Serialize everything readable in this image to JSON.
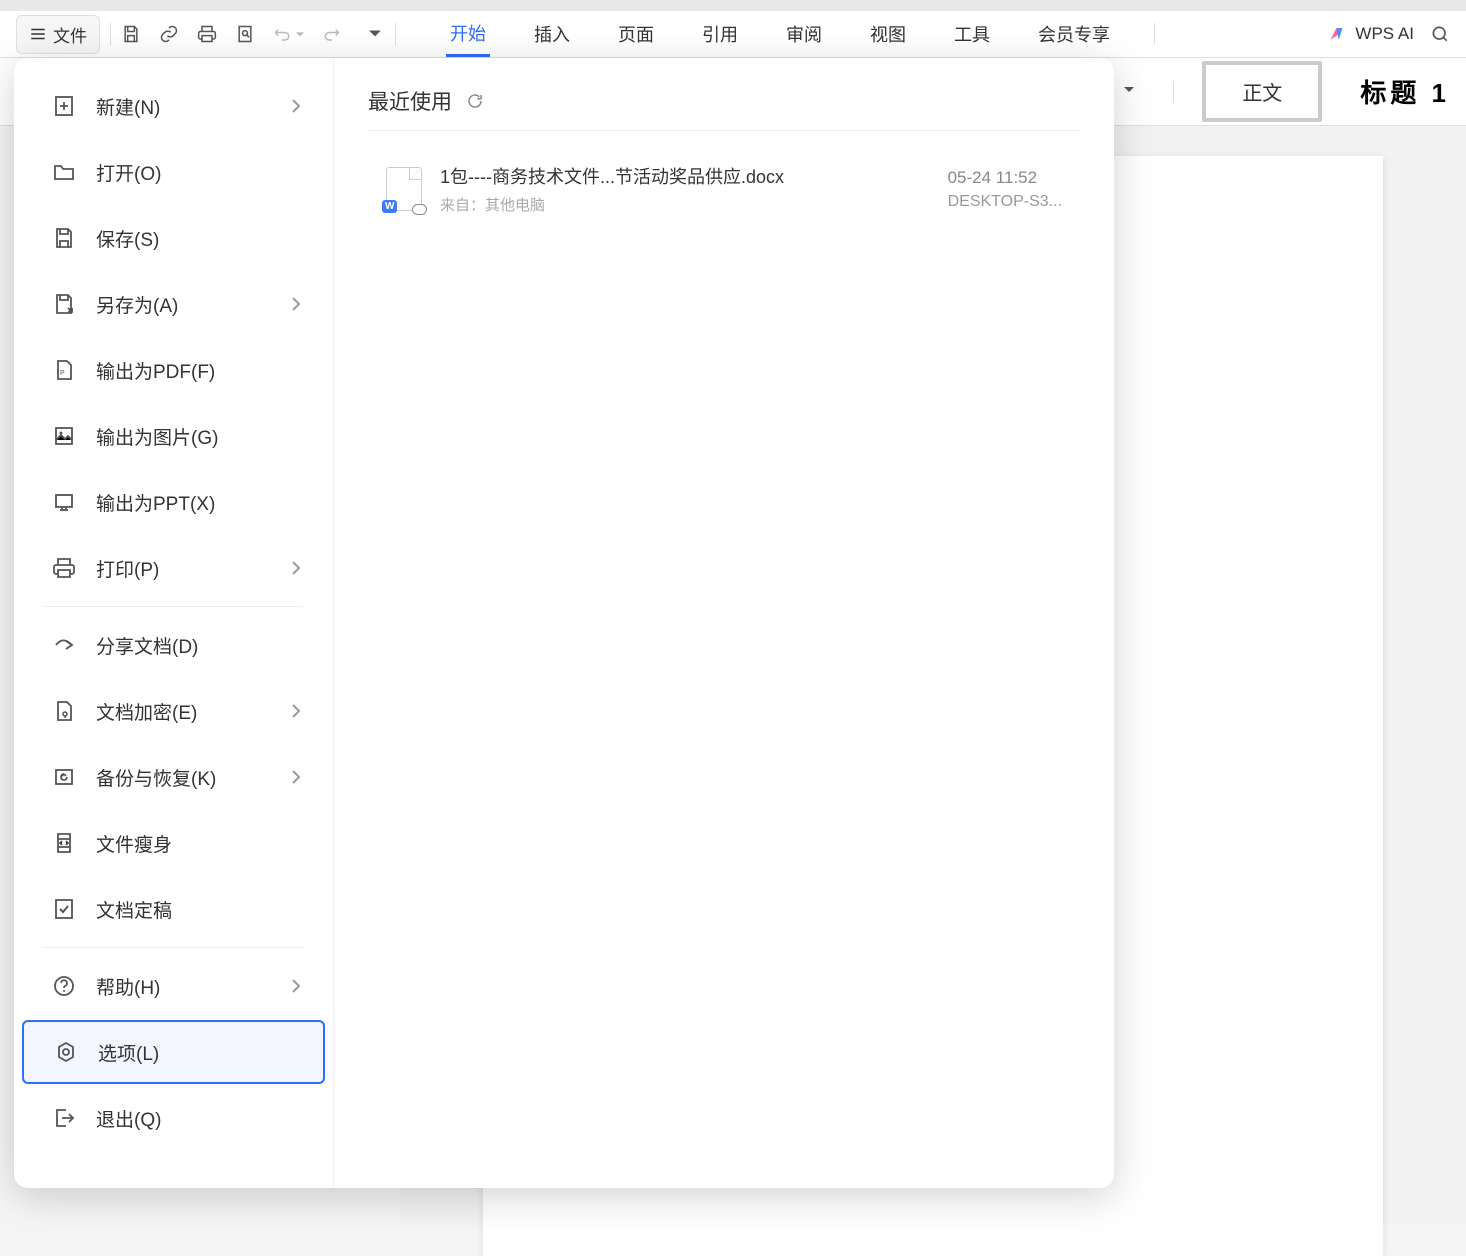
{
  "toolbar": {
    "file_label": "文件",
    "tabs": {
      "start": "开始",
      "insert": "插入",
      "page": "页面",
      "refs": "引用",
      "review": "审阅",
      "view": "视图",
      "tools": "工具",
      "vip": "会员专享"
    },
    "wps_ai": "WPS AI"
  },
  "file_menu": {
    "new": "新建(N)",
    "open": "打开(O)",
    "save": "保存(S)",
    "saveas": "另存为(A)",
    "export_pdf": "输出为PDF(F)",
    "export_img": "输出为图片(G)",
    "export_ppt": "输出为PPT(X)",
    "print": "打印(P)",
    "share": "分享文档(D)",
    "encrypt": "文档加密(E)",
    "backup": "备份与恢复(K)",
    "slim": "文件瘦身",
    "finalize": "文档定稿",
    "help": "帮助(H)",
    "options": "选项(L)",
    "exit": "退出(Q)"
  },
  "recent": {
    "title": "最近使用",
    "items": [
      {
        "name": "1包----商务技术文件...节活动奖品供应.docx",
        "source_label": "来自：",
        "source": "其他电脑",
        "date": "05-24 11:52",
        "host": "DESKTOP-S3..."
      }
    ]
  },
  "styles": {
    "normal": "正文",
    "heading1": "标题 1"
  }
}
